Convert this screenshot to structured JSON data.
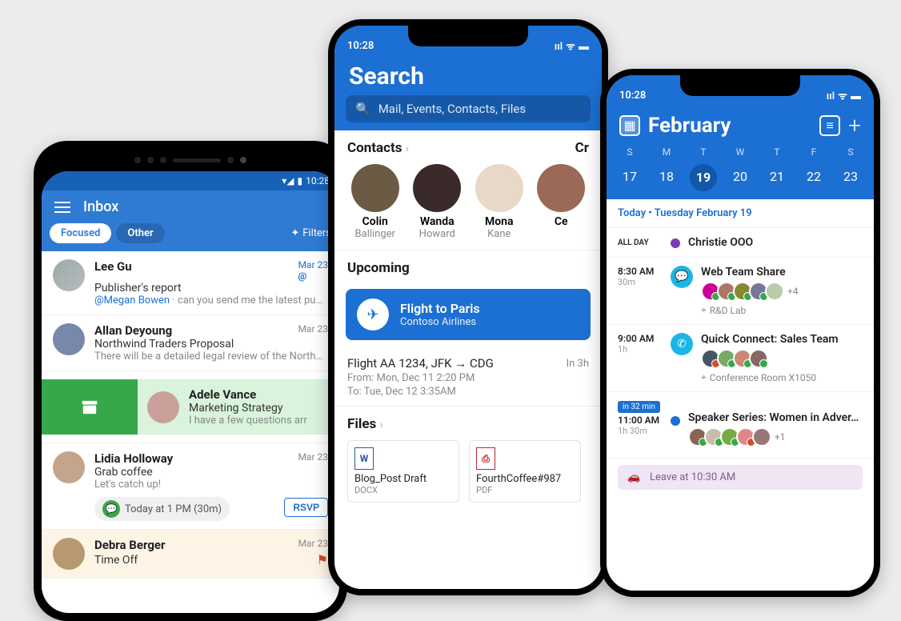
{
  "status_time": "10:28",
  "inbox": {
    "title": "Inbox",
    "tabs": {
      "focused": "Focused",
      "other": "Other"
    },
    "filters_label": "Filters",
    "messages": [
      {
        "sender": "Lee Gu",
        "date": "Mar 23",
        "subject": "Publisher's report",
        "mention": "@Megan Bowen",
        "snippet": " · can you send me the latest publi…",
        "date_blue": true,
        "mention_badge": "@"
      },
      {
        "sender": "Allan Deyoung",
        "date": "Mar 23",
        "subject": "Northwind Traders Proposal",
        "snippet": "There will be a detailed legal review of the Northw…"
      },
      {
        "swiped": true,
        "sender": "Adele Vance",
        "subject": "Marketing Strategy",
        "snippet": "I have a few questions arr"
      },
      {
        "sender": "Lidia Holloway",
        "date": "Mar 23",
        "subject": "Grab coffee",
        "snippet": "Let's catch up!",
        "event_chip": "Today at 1 PM (30m)",
        "rsvp": "RSVP"
      },
      {
        "sender": "Debra Berger",
        "date": "Mar 23",
        "subject": "Time Off",
        "highlighted": true,
        "flag": true
      }
    ]
  },
  "search": {
    "title": "Search",
    "placeholder": "Mail, Events, Contacts, Files",
    "contacts_head": "Contacts",
    "create_head": "Cr",
    "contacts": [
      {
        "first": "Colin",
        "last": "Ballinger"
      },
      {
        "first": "Wanda",
        "last": "Howard"
      },
      {
        "first": "Mona",
        "last": "Kane"
      },
      {
        "first": "Ce",
        "last": ""
      }
    ],
    "upcoming_head": "Upcoming",
    "upcoming_card": {
      "title": "Flight to Paris",
      "sub": "Contoso Airlines"
    },
    "flight": {
      "title": "Flight AA 1234, JFK → CDG",
      "eta": "In 3h",
      "from": "From: Mon, Dec 11 2:20 PM",
      "to": "To: Tue, Dec 12 3:35AM"
    },
    "files_head": "Files",
    "files": [
      {
        "icon": "W",
        "icon_color": "#2B579A",
        "name": "Blog_Post Draft",
        "type": "DOCX"
      },
      {
        "icon": "⎙",
        "icon_color": "#C1272D",
        "name": "FourthCoffee#987",
        "type": "PDF"
      }
    ]
  },
  "calendar": {
    "month": "February",
    "days_head": [
      "S",
      "M",
      "T",
      "W",
      "T",
      "F",
      "S"
    ],
    "days_num": [
      "17",
      "18",
      "19",
      "20",
      "21",
      "22",
      "23"
    ],
    "today_index": 2,
    "date_head": "Today • Tuesday February 19",
    "all_day_label": "ALL DAY",
    "all_day_event": "Christie OOO",
    "events": [
      {
        "time": "8:30 AM",
        "dur": "30m",
        "icon_bg": "#1BB6E6",
        "icon": "chat",
        "title": "Web Team Share",
        "plus": "+4",
        "location": "R&D Lab"
      },
      {
        "time": "9:00 AM",
        "dur": "1h",
        "icon_bg": "#1BB6E6",
        "icon": "phone",
        "title": "Quick Connect: Sales Team",
        "location": "Conference Room X1050"
      },
      {
        "in": "in 32 min",
        "time": "11:00 AM",
        "dur": "1h 30m",
        "dot": "#1C6FD3",
        "title": "Speaker Series: Women in Adver…",
        "plus": "+1"
      }
    ],
    "leave": "Leave at 10:30 AM"
  }
}
